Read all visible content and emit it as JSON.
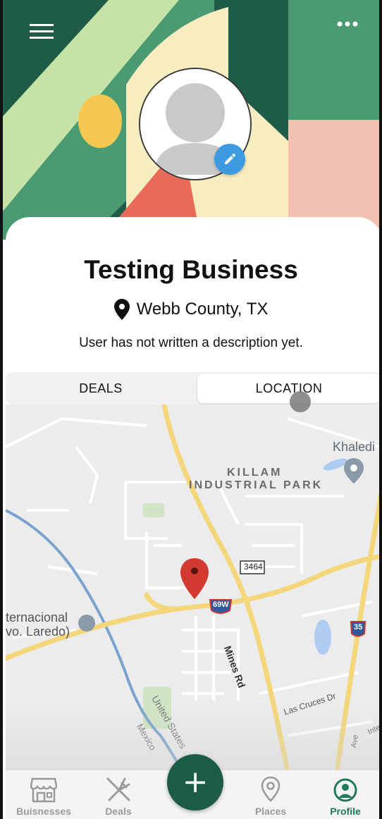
{
  "header": {
    "menu_icon": "hamburger-menu-icon",
    "more_icon": "more-dots-icon",
    "colors": {
      "dark_green": "#1f5c47",
      "green": "#4a9a72",
      "light_green": "#c5e3a6",
      "cream": "#f7edc1",
      "yellow": "#f5c851",
      "coral": "#e96a57",
      "pink": "#f3c1b2"
    }
  },
  "profile": {
    "avatar_icon": "default-avatar-icon",
    "edit_icon": "pencil-icon",
    "name": "Testing Business",
    "location_icon": "map-pin-icon",
    "location": "Webb County, TX",
    "description": "User has not written a description yet."
  },
  "tabs": [
    {
      "label": "DEALS",
      "active": false
    },
    {
      "label": "LOCATION",
      "active": true
    }
  ],
  "map": {
    "labels": {
      "killam1": "KILLAM",
      "killam2": "INDUSTRIAL PARK",
      "khaledi": "Khaledi",
      "internacional1": "ternacional",
      "internacional2": "vo. Laredo)",
      "mines_rd": "Mines Rd",
      "united_states": "United States",
      "mexico": "Mexico",
      "las_cruces": "Las Cruces Dr",
      "ave": "Ave",
      "inte": "Inte",
      "route_3464": "3464",
      "route_69w": "69W",
      "route_35": "35"
    },
    "marker_icon": "red-map-pin-icon"
  },
  "nav": {
    "items": [
      {
        "label": "Buisnesses",
        "icon": "storefront-icon",
        "active": false
      },
      {
        "label": "Deals",
        "icon": "fork-knife-icon",
        "active": false
      },
      {
        "label": "Places",
        "icon": "location-pin-icon",
        "active": false
      },
      {
        "label": "Profile",
        "icon": "user-circle-icon",
        "active": true
      }
    ],
    "fab_icon": "plus-icon",
    "fab_symbol": "+"
  }
}
